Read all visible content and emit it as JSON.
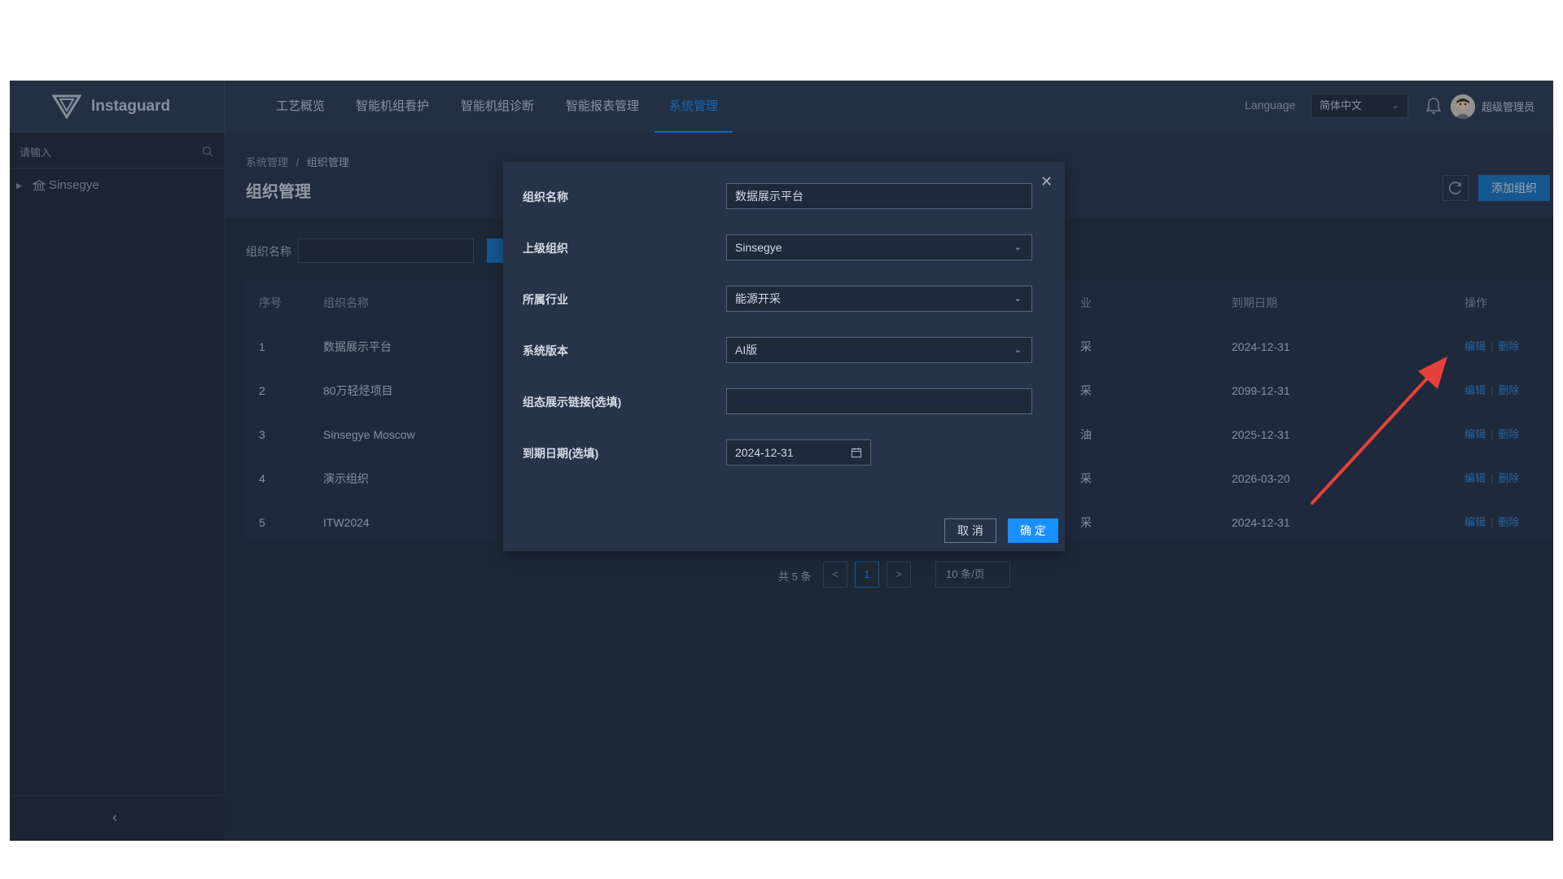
{
  "brand": {
    "name": "Instaguard"
  },
  "nav": {
    "items": [
      {
        "label": "工艺概览"
      },
      {
        "label": "智能机组看护"
      },
      {
        "label": "智能机组诊断"
      },
      {
        "label": "智能报表管理"
      },
      {
        "label": "系统管理"
      }
    ],
    "active_index": 4
  },
  "header": {
    "language_label": "Language",
    "language_value": "简体中文",
    "user_name": "超级管理员"
  },
  "sidebar": {
    "search_placeholder": "请输入",
    "tree": [
      {
        "label": "Sinsegye"
      }
    ]
  },
  "breadcrumb": {
    "parent": "系统管理",
    "separator": "/",
    "current": "组织管理"
  },
  "page": {
    "title": "组织管理",
    "add_button": "添加组织",
    "filter_label": "组织名称"
  },
  "table": {
    "headers": {
      "index": "序号",
      "name": "组织名称",
      "industry_partial": "业",
      "expire": "到期日期",
      "ops": "操作"
    },
    "rows": [
      {
        "index": "1",
        "name": "数据展示平台",
        "industry_partial": "采",
        "expire": "2024-12-31"
      },
      {
        "index": "2",
        "name": "80万轻烃项目",
        "industry_partial": "采",
        "expire": "2099-12-31"
      },
      {
        "index": "3",
        "name": "Sinsegye Moscow",
        "industry_partial": "油",
        "expire": "2025-12-31"
      },
      {
        "index": "4",
        "name": "演示组织",
        "industry_partial": "采",
        "expire": "2026-03-20"
      },
      {
        "index": "5",
        "name": "ITW2024",
        "industry_partial": "采",
        "expire": "2024-12-31"
      }
    ],
    "edit_label": "编辑",
    "delete_label": "删除"
  },
  "pagination": {
    "total_text": "共 5 条",
    "prev": "<",
    "current_page": "1",
    "next": ">",
    "page_size": "10 条/页"
  },
  "modal": {
    "fields": {
      "org_name": {
        "label": "组织名称",
        "value": "数据展示平台"
      },
      "parent_org": {
        "label": "上级组织",
        "value": "Sinsegye"
      },
      "industry": {
        "label": "所属行业",
        "value": "能源开采"
      },
      "version": {
        "label": "系统版本",
        "value": "AI版"
      },
      "config_link": {
        "label": "组态展示链接(选填)",
        "value": ""
      },
      "expire_date": {
        "label": "到期日期(选填)",
        "value": "2024-12-31"
      }
    },
    "cancel_label": "取 消",
    "ok_label": "确 定"
  },
  "colors": {
    "accent": "#1890ff",
    "annotation_arrow": "#e8403a",
    "background": "#222e3f",
    "topbar": "#2c3b54"
  },
  "icons": [
    "logo-icon",
    "search-icon",
    "bank-icon",
    "bell-icon",
    "avatar",
    "refresh-icon",
    "calendar-icon",
    "close-icon",
    "chevron-down-icon",
    "chevron-left-icon"
  ]
}
